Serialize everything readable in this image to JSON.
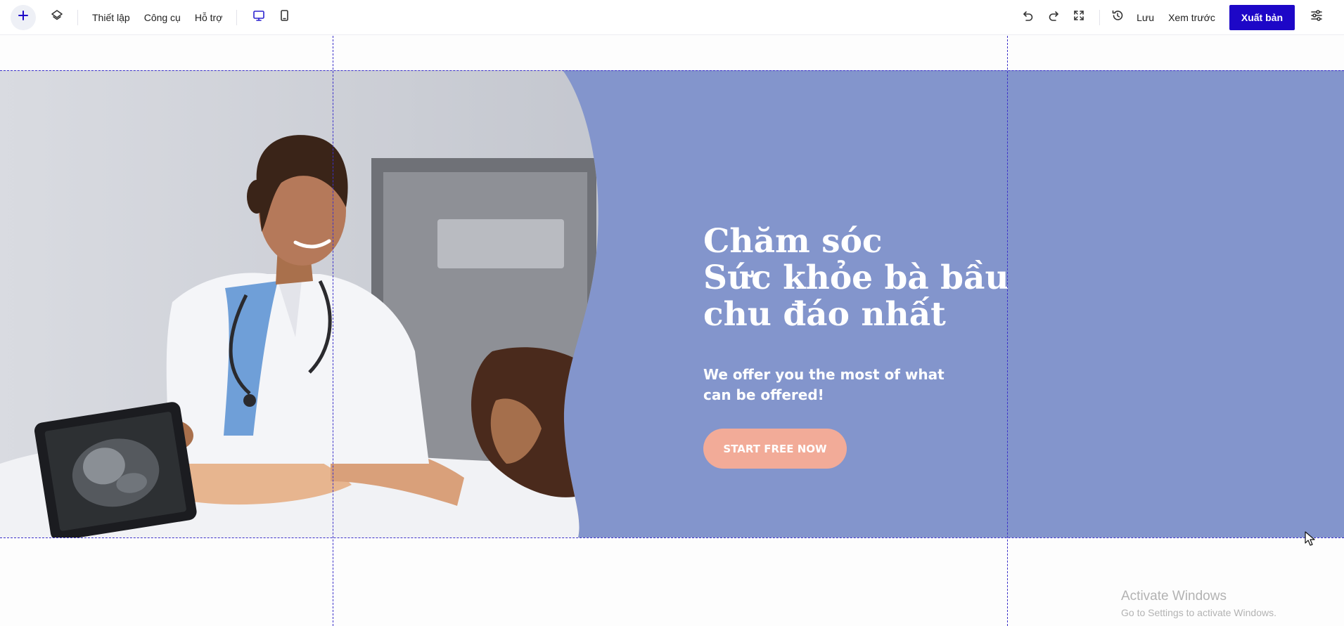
{
  "toolbar": {
    "add_icon": "plus-icon",
    "layers_icon": "layers-icon",
    "menu": [
      "Thiết lập",
      "Công cụ",
      "Hỗ trợ"
    ],
    "device_views": [
      {
        "name": "desktop-icon",
        "active": true
      },
      {
        "name": "mobile-icon",
        "active": false
      }
    ],
    "undo_icon": "undo-icon",
    "redo_icon": "redo-icon",
    "fullscreen_icon": "fullscreen-icon",
    "history_icon": "history-icon",
    "save_label": "Lưu",
    "preview_label": "Xem trước",
    "publish_label": "Xuất bản",
    "settings_icon": "sliders-icon",
    "colors": {
      "accent": "#1d07c7",
      "active_icon": "#2b22cf"
    }
  },
  "hero": {
    "title_lines": [
      "Chăm sóc",
      "Sức khỏe bà bầu",
      "chu đáo nhất"
    ],
    "subtitle": "We offer you the most of what can be offered!",
    "cta_label": "START FREE NOW",
    "image_icon": "doctor-ultrasound-photo",
    "colors": {
      "background": "#8395cc",
      "cta": "#f2ab98",
      "text": "#ffffff"
    }
  },
  "watermark": {
    "title": "Activate Windows",
    "subtitle": "Go to Settings to activate Windows."
  }
}
